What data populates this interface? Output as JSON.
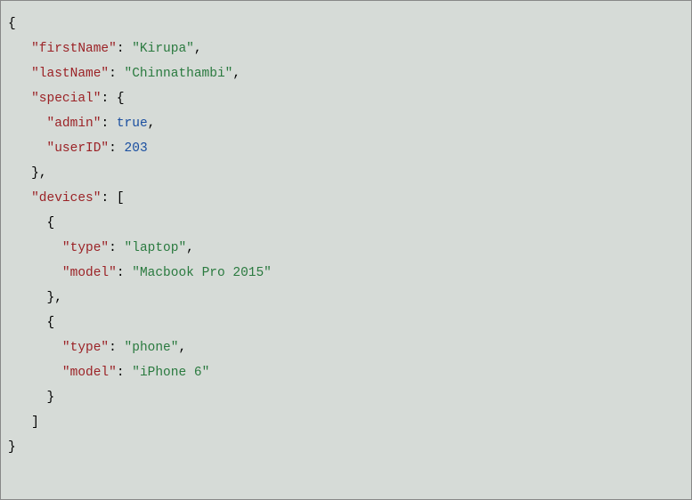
{
  "code": {
    "root_open": "{",
    "root_close": "}",
    "firstName_key": "\"firstName\"",
    "firstName_val": "\"Kirupa\"",
    "lastName_key": "\"lastName\"",
    "lastName_val": "\"Chinnathambi\"",
    "special_key": "\"special\"",
    "special_open": "{",
    "special_close": "}",
    "admin_key": "\"admin\"",
    "admin_val": "true",
    "userID_key": "\"userID\"",
    "userID_val": "203",
    "devices_key": "\"devices\"",
    "devices_open": "[",
    "devices_close": "]",
    "dev_obj_open": "{",
    "dev_obj_close": "}",
    "type_key": "\"type\"",
    "model_key": "\"model\"",
    "dev1_type_val": "\"laptop\"",
    "dev1_model_val": "\"Macbook Pro 2015\"",
    "dev2_type_val": "\"phone\"",
    "dev2_model_val": "\"iPhone 6\"",
    "colon": ":",
    "comma": ",",
    "space": " "
  }
}
